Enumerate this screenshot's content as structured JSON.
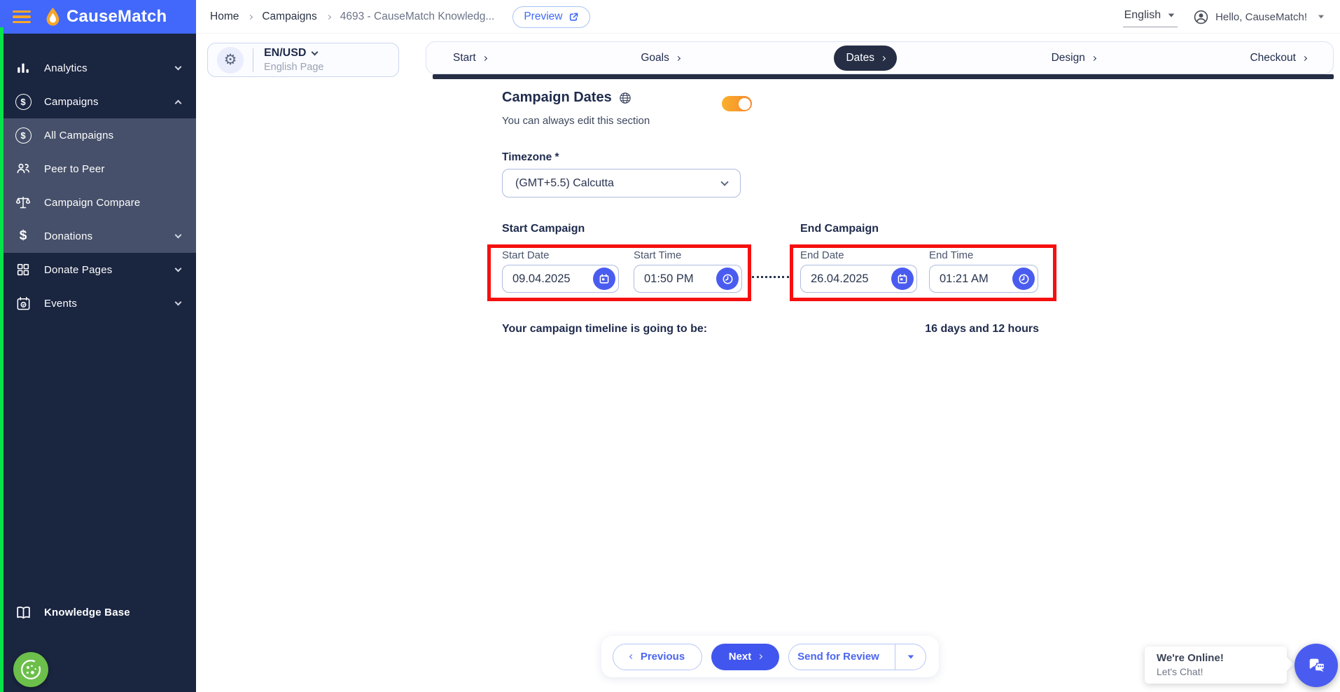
{
  "header": {
    "brand": "CauseMatch",
    "breadcrumb": {
      "home": "Home",
      "campaigns": "Campaigns",
      "campaign_name": "4693  -  CauseMatch Knowledg..."
    },
    "preview_label": "Preview",
    "language": "English",
    "greeting": "Hello, CauseMatch!"
  },
  "locale_switcher": {
    "value": "EN/USD",
    "subtitle": "English Page"
  },
  "stepper": {
    "active": "Dates",
    "items": [
      {
        "label": "Start"
      },
      {
        "label": "Goals"
      },
      {
        "label": "Dates"
      },
      {
        "label": "Design"
      },
      {
        "label": "Checkout"
      }
    ]
  },
  "sidebar": {
    "items": [
      {
        "label": "Analytics",
        "icon": "bar-chart-icon",
        "chevron": "down"
      },
      {
        "label": "Campaigns",
        "icon": "dollar-circle-icon",
        "chevron": "up"
      },
      {
        "label": "All Campaigns",
        "icon": "dollar-circle-icon"
      },
      {
        "label": "Peer to Peer",
        "icon": "people-icon"
      },
      {
        "label": "Campaign Compare",
        "icon": "scale-icon"
      },
      {
        "label": "Donations",
        "icon": "dollar-icon",
        "chevron": "down"
      },
      {
        "label": "Donate Pages",
        "icon": "grid-icon",
        "chevron": "down"
      },
      {
        "label": "Events",
        "icon": "calendar-icon",
        "chevron": "down"
      }
    ],
    "knowledge_base_label": "Knowledge Base"
  },
  "dates_form": {
    "section_title": "Campaign Dates",
    "section_subtitle": "You can always edit this section",
    "toggle_state": "on",
    "timezone_label": "Timezone *",
    "timezone_value": "(GMT+5.5) Calcutta",
    "start_campaign_title": "Start Campaign",
    "end_campaign_title": "End Campaign",
    "start_date_label": "Start Date",
    "start_date_value": "09.04.2025",
    "start_time_label": "Start Time",
    "start_time_value": "01:50 PM",
    "end_date_label": "End Date",
    "end_date_value": "26.04.2025",
    "end_time_label": "End Time",
    "end_time_value": "01:21 AM",
    "timeline_label": "Your campaign timeline is going to be:",
    "timeline_value": "16 days and 12 hours"
  },
  "footer_nav": {
    "previous_label": "Previous",
    "next_label": "Next",
    "send_for_review_label": "Send for Review"
  },
  "chat_widget": {
    "status": "We're Online!",
    "cta": "Let's Chat!"
  },
  "colors": {
    "header_blue": "#4168fa",
    "sidebar_navy": "#1a2540",
    "sidebar_submenu": "#46506a",
    "accent_blue": "#4a5cf0",
    "step_dark": "#252e45",
    "highlight_red": "#f5100f",
    "toggle_orange": "#f79a2b",
    "edge_green": "#07e34b",
    "cookie_green": "#6bbf4a"
  }
}
